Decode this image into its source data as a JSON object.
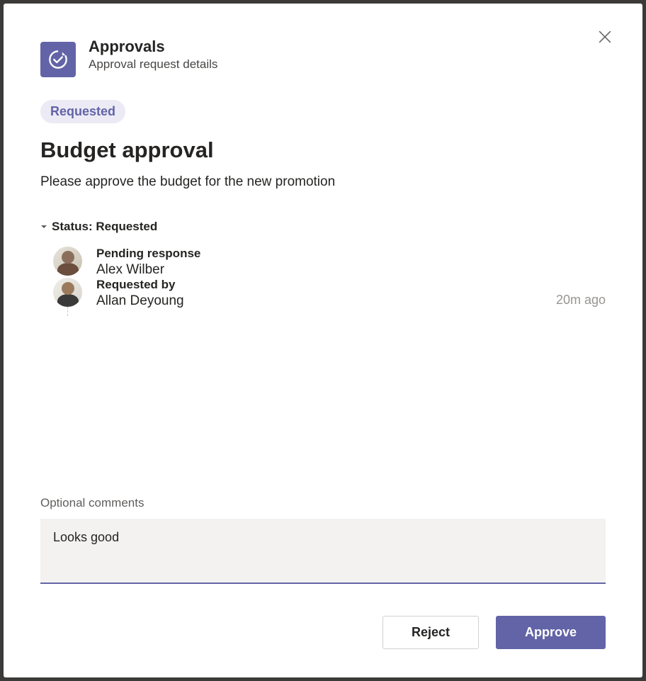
{
  "header": {
    "app_title": "Approvals",
    "app_subtitle": "Approval request details"
  },
  "status_badge": "Requested",
  "request": {
    "title": "Budget approval",
    "description": "Please approve the budget for the new promotion"
  },
  "status_section": {
    "header": "Status: Requested",
    "approvers": [
      {
        "status_label": "Pending response",
        "name": "Alex Wilber",
        "timestamp": ""
      },
      {
        "status_label": "Requested by",
        "name": "Allan Deyoung",
        "timestamp": "20m ago"
      }
    ]
  },
  "comments": {
    "label": "Optional comments",
    "value": "Looks good"
  },
  "footer": {
    "reject_label": "Reject",
    "approve_label": "Approve"
  }
}
